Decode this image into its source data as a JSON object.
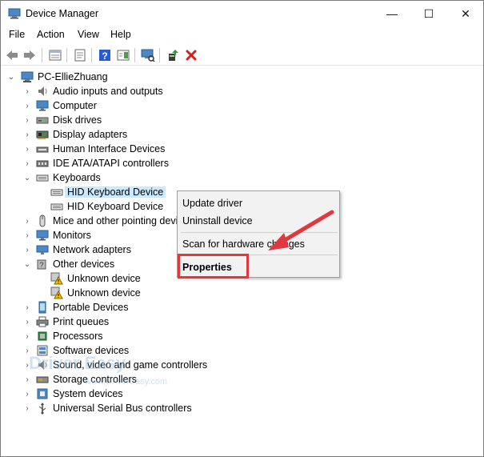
{
  "window": {
    "title": "Device Manager"
  },
  "window_controls": {
    "minimize": "—",
    "maximize": "☐",
    "close": "✕"
  },
  "menu": [
    "File",
    "Action",
    "View",
    "Help"
  ],
  "tree": {
    "root": "PC-EllieZhuang",
    "items": [
      {
        "label": "Audio inputs and outputs",
        "icon": "speaker-icon"
      },
      {
        "label": "Computer",
        "icon": "monitor-icon"
      },
      {
        "label": "Disk drives",
        "icon": "disk-drive-icon"
      },
      {
        "label": "Display adapters",
        "icon": "display-adapter-icon"
      },
      {
        "label": "Human Interface Devices",
        "icon": "hid-icon"
      },
      {
        "label": "IDE ATA/ATAPI controllers",
        "icon": "ide-controller-icon"
      },
      {
        "label": "Keyboards",
        "icon": "keyboard-icon",
        "expanded": true
      },
      {
        "label": "HID Keyboard Device",
        "icon": "keyboard-icon",
        "child": true,
        "selected": true
      },
      {
        "label": "HID Keyboard Device",
        "icon": "keyboard-icon",
        "child": true
      },
      {
        "label": "Mice and other pointing devices",
        "icon": "mouse-icon"
      },
      {
        "label": "Monitors",
        "icon": "monitor-icon"
      },
      {
        "label": "Network adapters",
        "icon": "network-adapter-icon"
      },
      {
        "label": "Other devices",
        "icon": "other-devices-icon",
        "expanded": true
      },
      {
        "label": "Unknown device",
        "icon": "warning-device-icon",
        "child": true
      },
      {
        "label": "Unknown device",
        "icon": "warning-device-icon",
        "child": true
      },
      {
        "label": "Portable Devices",
        "icon": "portable-device-icon"
      },
      {
        "label": "Print queues",
        "icon": "printer-icon"
      },
      {
        "label": "Processors",
        "icon": "processor-icon"
      },
      {
        "label": "Software devices",
        "icon": "software-device-icon"
      },
      {
        "label": "Sound, video and game controllers",
        "icon": "speaker-icon"
      },
      {
        "label": "Storage controllers",
        "icon": "storage-controller-icon"
      },
      {
        "label": "System devices",
        "icon": "system-device-icon"
      },
      {
        "label": "Universal Serial Bus controllers",
        "icon": "usb-icon"
      }
    ]
  },
  "context_menu": {
    "update_driver": "Update driver",
    "uninstall_device": "Uninstall device",
    "scan": "Scan for hardware changes",
    "properties": "Properties"
  },
  "watermark": {
    "brand": "Driver Easy",
    "url": "www.DriverEasy.com"
  },
  "colors": {
    "selection": "#cce8ff",
    "highlight": "#e0383e",
    "remove_x": "#d81e1e",
    "help": "#2a5bd7"
  }
}
